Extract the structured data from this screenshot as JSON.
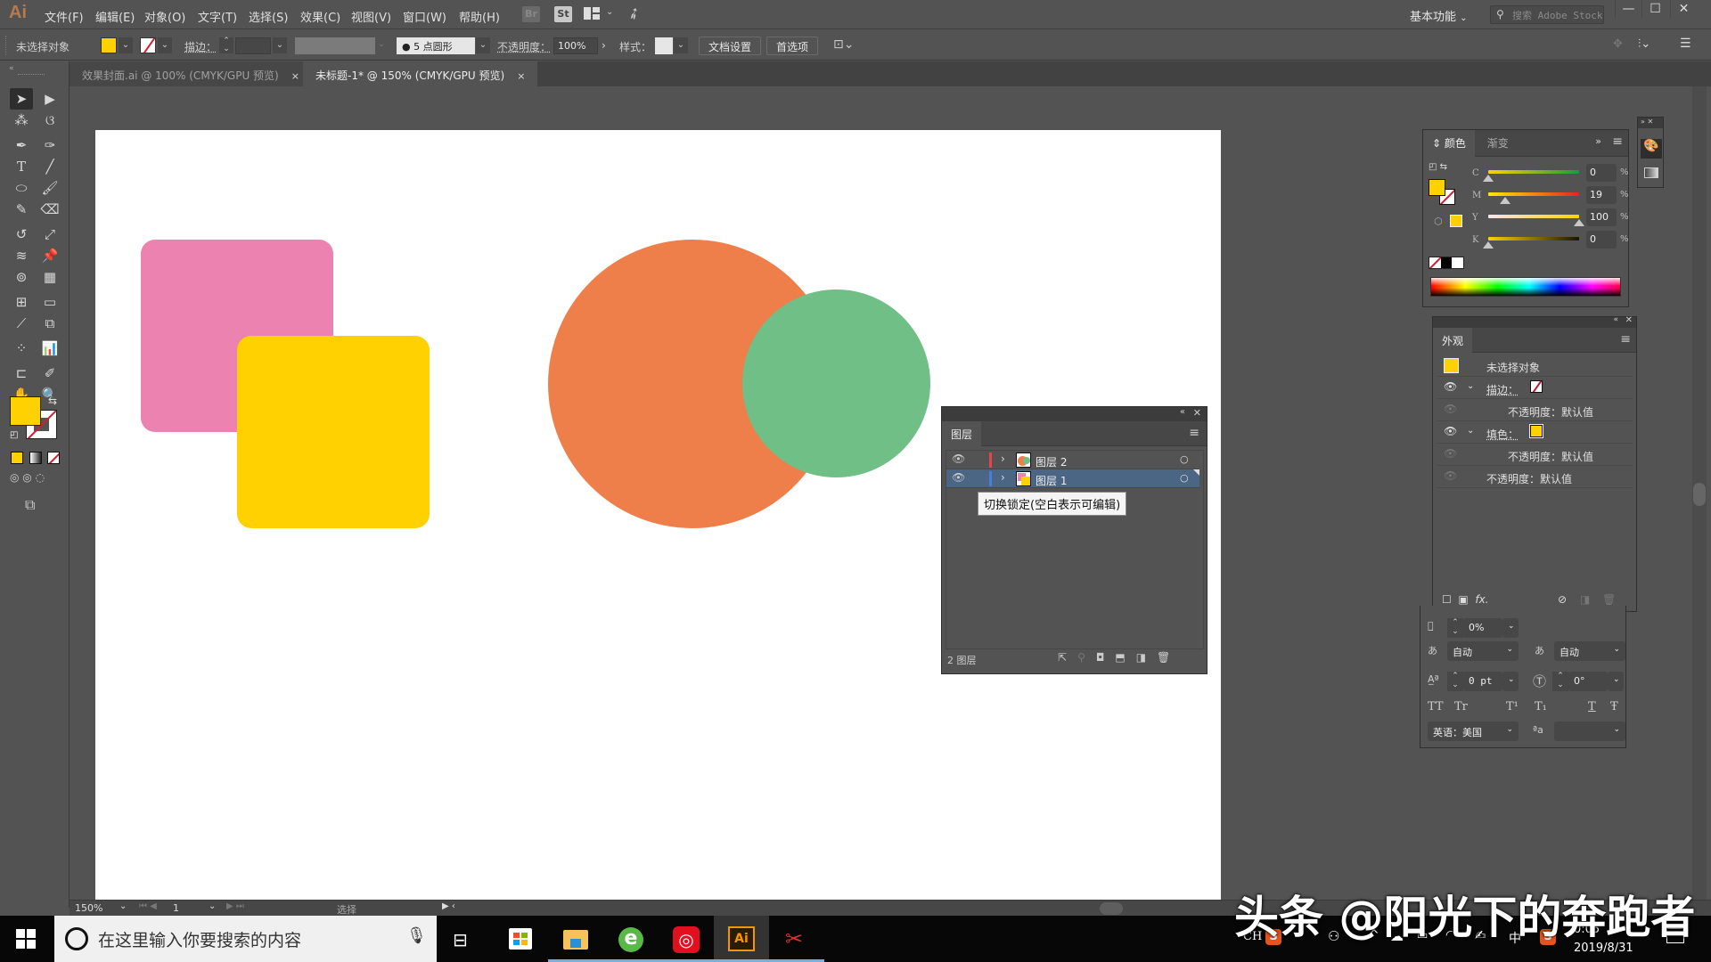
{
  "app": {
    "logo": "Ai",
    "menus": [
      "文件(F)",
      "编辑(E)",
      "对象(O)",
      "文字(T)",
      "选择(S)",
      "效果(C)",
      "视图(V)",
      "窗口(W)",
      "帮助(H)"
    ],
    "bridge_label": "Br",
    "stock_label": "St",
    "workspace": "基本功能",
    "stock_search_placeholder": "搜索 Adobe Stock",
    "window_controls": {
      "minimize": "—",
      "maximize": "☐",
      "close": "✕"
    }
  },
  "control_bar": {
    "selection_status": "未选择对象",
    "fill_color": "#ffd100",
    "stroke_label": "描边：",
    "brush": "5 点圆形",
    "opacity_label": "不透明度：",
    "opacity_value": "100%",
    "style_label": "样式：",
    "doc_setup_button": "文档设置",
    "preferences_button": "首选项"
  },
  "tabs": [
    {
      "label": "效果封面.ai @ 100% (CMYK/GPU 预览)",
      "active": false
    },
    {
      "label": "未标题-1* @ 150% (CMYK/GPU 预览)",
      "active": true
    }
  ],
  "tab_close": "×",
  "artwork": {
    "shapes": [
      {
        "name": "pink-rounded-square",
        "type": "rect",
        "color": "#ec82b0"
      },
      {
        "name": "yellow-rounded-square",
        "type": "rect",
        "color": "#ffd100"
      },
      {
        "name": "orange-circle",
        "type": "circle",
        "color": "#ee7f4b"
      },
      {
        "name": "green-circle",
        "type": "circle",
        "color": "#6fbf87"
      }
    ]
  },
  "layers_panel": {
    "title": "图层",
    "layers": [
      {
        "name": "图层 2",
        "color": "#e8434b",
        "selected": false
      },
      {
        "name": "图层 1",
        "color": "#4c7bdc",
        "selected": true
      }
    ],
    "footer_count": "2 图层",
    "tooltip": "切换锁定(空白表示可编辑)"
  },
  "color_panel": {
    "tabs": [
      "颜色",
      "渐变"
    ],
    "channels": [
      {
        "label": "C",
        "value": "0",
        "percent": 0
      },
      {
        "label": "M",
        "value": "19",
        "percent": 19
      },
      {
        "label": "Y",
        "value": "100",
        "percent": 100
      },
      {
        "label": "K",
        "value": "0",
        "percent": 0
      }
    ],
    "unit": "%"
  },
  "appearance_panel": {
    "title": "外观",
    "header": "未选择对象",
    "stroke_label": "描边：",
    "fill_label": "填色：",
    "opacity_default": "不透明度：默认值"
  },
  "character_panel": {
    "tracking": "0%",
    "auto1": "自动",
    "auto2": "自动",
    "baseline": "0 pt",
    "rotation": "0°",
    "language": "英语：美国",
    "case_buttons": [
      "TT",
      "Tr",
      "T¹",
      "T₁",
      "T",
      "Ŧ"
    ]
  },
  "status_bar": {
    "zoom": "150%",
    "artboard": "1",
    "tool": "选择"
  },
  "taskbar": {
    "search_placeholder": "在这里输入你要搜索的内容",
    "ime_ch": "CH",
    "ime_zh": "中",
    "time": "0:05",
    "date": "2019/8/31"
  },
  "watermark": "头条 @阳光下的奔跑者"
}
